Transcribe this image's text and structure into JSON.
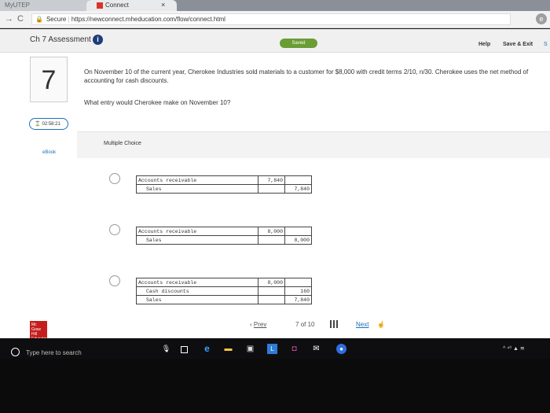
{
  "browser": {
    "tab_inactive_label": "MyUTEP",
    "tab_active_label": "Connect",
    "tab_close": "×",
    "back": "→",
    "reload": "C",
    "secure_label": "Secure",
    "url": "https://newconnect.mheducation.com/flow/connect.html",
    "profile_initial": "e"
  },
  "header": {
    "title": "Ch 7 Assessment",
    "info_icon": "i",
    "saved_badge": "Saved",
    "help": "Help",
    "save_exit": "Save & Exit",
    "save_exit_cut": "S"
  },
  "question": {
    "number": "7",
    "text": "On November 10 of the current year, Cherokee Industries sold materials to a customer for $8,000 with credit terms 2/10, n/30. Cherokee uses the net method of accounting for cash discounts.",
    "prompt": "What entry would Cherokee make on November 10?",
    "timer": "02:58:21",
    "ebook": "eBook",
    "type_label": "Multiple Choice"
  },
  "options": [
    {
      "rows": [
        {
          "account": "Accounts receivable",
          "debit": "7,840",
          "credit": ""
        },
        {
          "account": "Sales",
          "debit": "",
          "credit": "7,840"
        }
      ]
    },
    {
      "rows": [
        {
          "account": "Accounts receivable",
          "debit": "8,000",
          "credit": ""
        },
        {
          "account": "Sales",
          "debit": "",
          "credit": "8,000"
        }
      ]
    },
    {
      "rows": [
        {
          "account": "Accounts receivable",
          "debit": "8,000",
          "credit": ""
        },
        {
          "account": "Cash discounts",
          "debit": "",
          "credit": "160"
        },
        {
          "account": "Sales",
          "debit": "",
          "credit": "7,840"
        }
      ]
    }
  ],
  "pagination": {
    "prev": "Prev",
    "prev_chevron": "‹",
    "current": "7",
    "of": "of",
    "total": "10",
    "next": "Next"
  },
  "logo": {
    "text": "Mc Graw Hill Education"
  },
  "taskbar": {
    "search_placeholder": "Type here to search",
    "tray_text": "^ ⁴⁰ ▲ ≋"
  },
  "colors": {
    "accent_blue": "#1d6fb8",
    "saved_green": "#6a9d34",
    "brand_red": "#c41e1e"
  }
}
